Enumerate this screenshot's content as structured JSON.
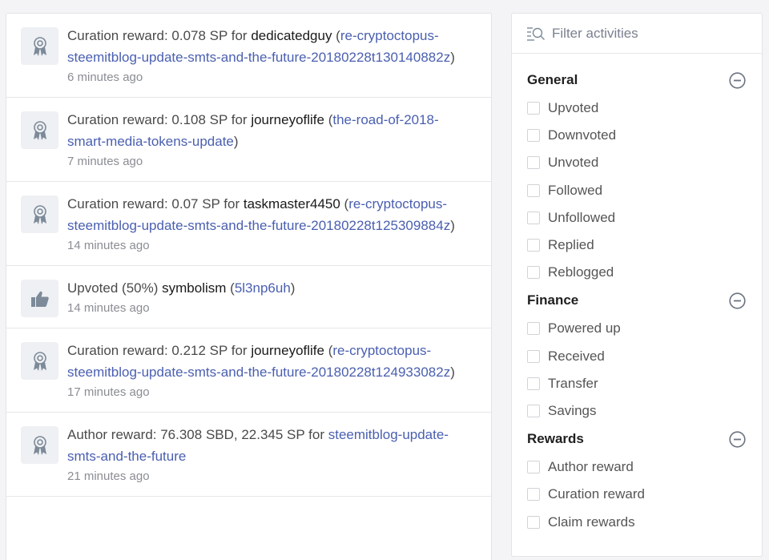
{
  "feed": {
    "items": [
      {
        "icon": "award-icon",
        "prefix": "Curation reward: 0.078 SP for ",
        "user": "dedicatedguy",
        "open": " (",
        "link": "re-cryptoctopus-steemitblog-update-smts-and-the-future-20180228t130140882z",
        "close": ")",
        "time": "6 minutes ago"
      },
      {
        "icon": "award-icon",
        "prefix": "Curation reward: 0.108 SP for ",
        "user": "journeyoflife",
        "open": " (",
        "link": "the-road-of-2018-smart-media-tokens-update",
        "close": ")",
        "time": "7 minutes ago"
      },
      {
        "icon": "award-icon",
        "prefix": "Curation reward: 0.07 SP for ",
        "user": "taskmaster4450",
        "open": " (",
        "link": "re-cryptoctopus-steemitblog-update-smts-and-the-future-20180228t125309884z",
        "close": ")",
        "time": "14 minutes ago"
      },
      {
        "icon": "thumbs-up-icon",
        "prefix": "Upvoted (50%) ",
        "user": "symbolism",
        "open": " (",
        "link": "5l3np6uh",
        "close": ")",
        "time": "14 minutes ago"
      },
      {
        "icon": "award-icon",
        "prefix": "Curation reward: 0.212 SP for ",
        "user": "journeyoflife",
        "open": " (",
        "link": "re-cryptoctopus-steemitblog-update-smts-and-the-future-20180228t124933082z",
        "close": ")",
        "time": "17 minutes ago"
      },
      {
        "icon": "award-icon",
        "prefix": "Author reward: 76.308 SBD, 22.345 SP for ",
        "user": "",
        "open": "",
        "link": "steemitblog-update-smts-and-the-future",
        "close": "",
        "time": "21 minutes ago"
      }
    ]
  },
  "filter": {
    "placeholder": "Filter activities",
    "groups": [
      {
        "title": "General",
        "options": [
          "Upvoted",
          "Downvoted",
          "Unvoted",
          "Followed",
          "Unfollowed",
          "Replied",
          "Reblogged"
        ]
      },
      {
        "title": "Finance",
        "options": [
          "Powered up",
          "Received",
          "Transfer",
          "Savings"
        ]
      },
      {
        "title": "Rewards",
        "options": [
          "Author reward",
          "Curation reward",
          "Claim rewards"
        ]
      }
    ]
  },
  "colors": {
    "link": "#4a5fb0",
    "icon": "#7d8a99",
    "toggle": "#6b7280"
  }
}
